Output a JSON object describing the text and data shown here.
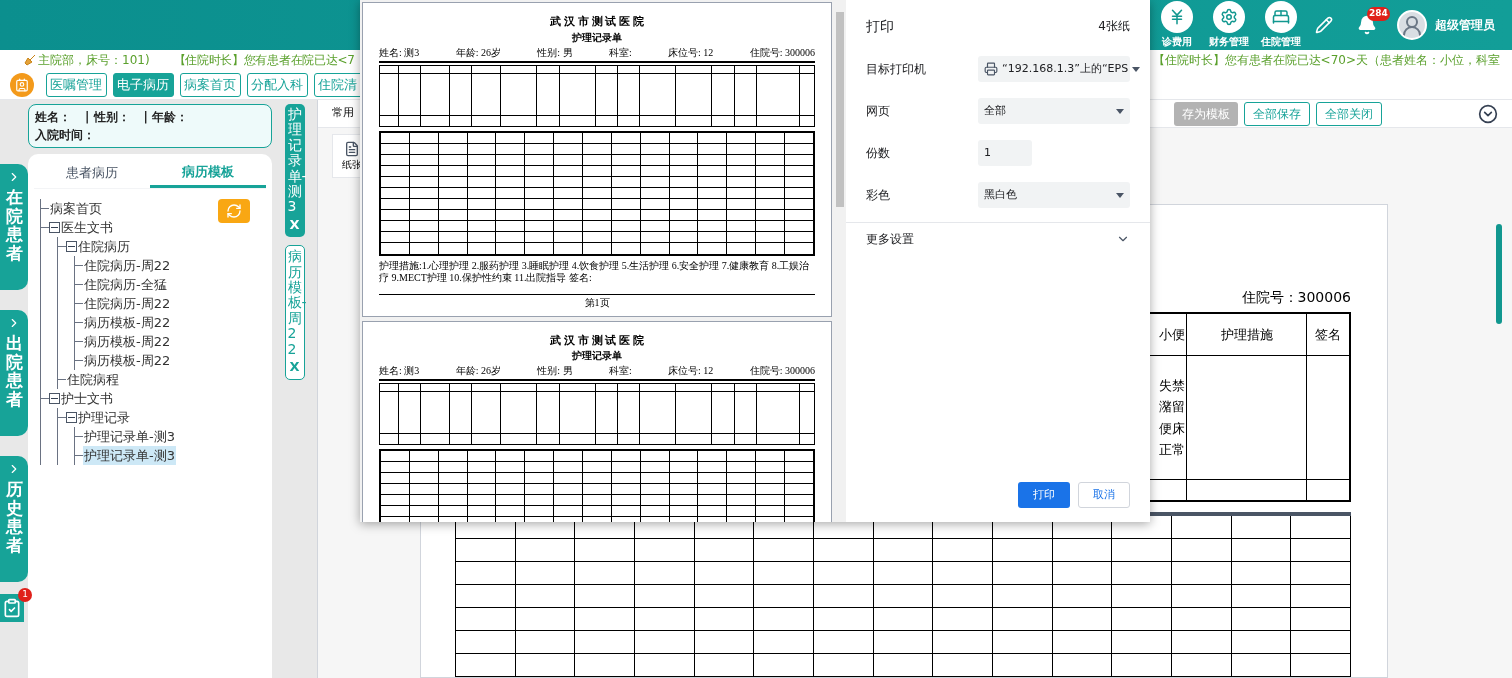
{
  "header": {
    "menu": [
      {
        "label": "诊费用",
        "kind": "fee"
      },
      {
        "label": "财务管理",
        "kind": "finance"
      },
      {
        "label": "住院管理",
        "kind": "ward"
      }
    ],
    "notifications": "284",
    "user": "超级管理员"
  },
  "notice_left": [
    "主院部，床号：101)",
    "【住院时长】您有患者在院已达<7"
  ],
  "notice_right": "【住院时长】您有患者在院已达<70>天（患者姓名：小位，科室",
  "nav_tabs": [
    {
      "label": "医嘱管理",
      "selected": false
    },
    {
      "label": "电子病历",
      "selected": true
    },
    {
      "label": "病案首页",
      "selected": false
    },
    {
      "label": "分配入科",
      "selected": false
    },
    {
      "label": "住院清",
      "selected": false
    }
  ],
  "side_rail": [
    {
      "label": "在院患者"
    },
    {
      "label": "出院患者"
    },
    {
      "label": "历史患者"
    }
  ],
  "task_badge": "1",
  "patient": {
    "line1": [
      "姓名：",
      "| 性别：",
      "| 年龄："
    ],
    "line2": "入院时间："
  },
  "record_tabs": [
    {
      "label": "患者病历",
      "selected": false
    },
    {
      "label": "病历模板",
      "selected": true
    }
  ],
  "tree": [
    {
      "label": "病案首页",
      "selected": false
    },
    {
      "label": "医生文书",
      "selected": false,
      "expanded": true,
      "children": [
        {
          "label": "住院病历",
          "selected": false,
          "expanded": true,
          "children": [
            {
              "label": "住院病历-周22",
              "selected": false
            },
            {
              "label": "住院病历-全猛",
              "selected": false
            },
            {
              "label": "住院病历-周22",
              "selected": false
            },
            {
              "label": "病历模板-周22",
              "selected": false
            },
            {
              "label": "病历模板-周22",
              "selected": false
            },
            {
              "label": "病历模板-周22",
              "selected": false
            }
          ]
        },
        {
          "label": "住院病程",
          "selected": false
        }
      ]
    },
    {
      "label": "护士文书",
      "selected": false,
      "expanded": true,
      "children": [
        {
          "label": "护理记录",
          "selected": false,
          "expanded": true,
          "children": [
            {
              "label": "护理记录单-测3",
              "selected": false
            },
            {
              "label": "护理记录单-测3",
              "selected": true
            }
          ]
        }
      ]
    }
  ],
  "open_docs": [
    {
      "label": "护理记录单-测3",
      "close": "X",
      "selected": true
    },
    {
      "label": "病历模板-周22",
      "close": "X",
      "selected": false
    }
  ],
  "toolbar": {
    "tab": "常用",
    "card": "纸张",
    "buttons": [
      {
        "label": "存为模板",
        "disabled": true
      },
      {
        "label": "全部保存",
        "disabled": false
      },
      {
        "label": "全部关闭",
        "disabled": false
      }
    ]
  },
  "document": {
    "admission_no": "住院号：300006",
    "columns": [
      "小便",
      "护理措施",
      "签名"
    ],
    "urine_options": [
      "失禁",
      "潴留",
      "便床",
      "正常"
    ]
  },
  "print_dialog": {
    "title": "打印",
    "sheets": "4张纸",
    "fields": [
      {
        "kind": "select",
        "label": "目标打印机",
        "value": "“192.168.1.3”上的“EPS",
        "printer": true
      },
      {
        "kind": "select",
        "label": "网页",
        "value": "全部"
      },
      {
        "kind": "input",
        "label": "份数",
        "value": "1"
      },
      {
        "kind": "select",
        "label": "彩色",
        "value": "黑白色"
      }
    ],
    "more": "更多设置",
    "print": "打印",
    "cancel": "取消",
    "pages": [
      {
        "hospital": "武 汉 市 测 试 医 院",
        "form": "护理记录单",
        "meta": [
          "姓名: 测3",
          "年龄: 26岁",
          "性别: 男",
          "科室:",
          "床位号: 12",
          "住院号: 300006"
        ],
        "footer": "护理措施:1.心理护理 2.服药护理 3.睡眠护理 4.饮食护理 5.生活护理 6.安全护理 7.健康教育 8.工娱治疗 9.MECT护理 10.保护性约束 11.出院指导  签名:",
        "page_no": "第1页"
      },
      {
        "hospital": "武 汉 市 测 试 医 院",
        "form": "护理记录单",
        "meta": [
          "姓名: 测3",
          "年龄: 26岁",
          "性别: 男",
          "科室:",
          "床位号: 12",
          "住院号: 300006"
        ]
      }
    ]
  }
}
